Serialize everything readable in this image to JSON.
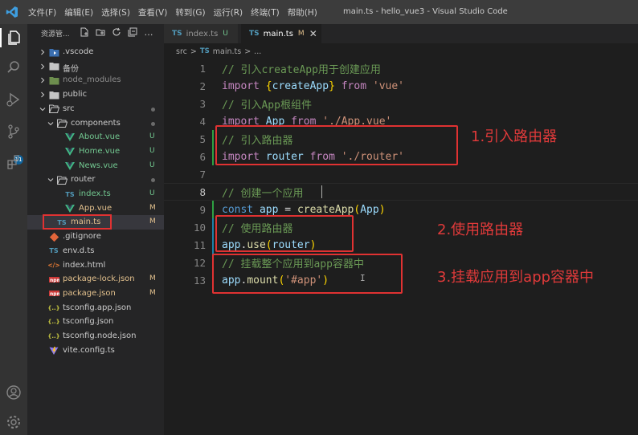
{
  "window": {
    "title": "main.ts - hello_vue3 - Visual Studio Code",
    "menu": [
      "文件(F)",
      "编辑(E)",
      "选择(S)",
      "查看(V)",
      "转到(G)",
      "运行(R)",
      "终端(T)",
      "帮助(H)"
    ]
  },
  "activitybar": {
    "icons": [
      "explorer-icon",
      "search-icon",
      "run-debug-icon",
      "source-control-icon",
      "extensions-icon",
      "account-icon",
      "settings-gear-icon"
    ],
    "scm_badge": "11"
  },
  "sidebar": {
    "title": "资源管...",
    "tree": [
      {
        "name": ".vscode",
        "type": "folder",
        "icon": "vscode-folder-icon",
        "stat": ""
      },
      {
        "name": "备份",
        "type": "folder",
        "icon": "folder-icon",
        "stat": ""
      },
      {
        "name": "node_modules",
        "type": "folder",
        "icon": "node-folder-icon",
        "stat": ""
      },
      {
        "name": "public",
        "type": "folder",
        "icon": "folder-icon",
        "stat": ""
      },
      {
        "name": "src",
        "type": "folder-open",
        "icon": "folder-open-icon",
        "stat": "dot"
      },
      {
        "name": "components",
        "type": "folder-open",
        "icon": "folder-open-icon",
        "stat": "dot"
      },
      {
        "name": "About.vue",
        "type": "vue",
        "icon": "vue-icon",
        "stat": "U"
      },
      {
        "name": "Home.vue",
        "type": "vue",
        "icon": "vue-icon",
        "stat": "U"
      },
      {
        "name": "News.vue",
        "type": "vue",
        "icon": "vue-icon",
        "stat": "U"
      },
      {
        "name": "router",
        "type": "folder-open",
        "icon": "folder-open-icon",
        "stat": "dot"
      },
      {
        "name": "index.ts",
        "type": "ts",
        "icon": "ts-icon",
        "stat": "U"
      },
      {
        "name": "App.vue",
        "type": "vue",
        "icon": "vue-icon",
        "stat": "M"
      },
      {
        "name": "main.ts",
        "type": "ts",
        "icon": "ts-icon",
        "stat": "M"
      },
      {
        "name": ".gitignore",
        "type": "git",
        "icon": "git-icon",
        "stat": ""
      },
      {
        "name": "env.d.ts",
        "type": "ts",
        "icon": "ts-icon",
        "stat": ""
      },
      {
        "name": "index.html",
        "type": "html",
        "icon": "html-icon",
        "stat": ""
      },
      {
        "name": "package-lock.json",
        "type": "npm",
        "icon": "npm-icon",
        "stat": "M"
      },
      {
        "name": "package.json",
        "type": "npm",
        "icon": "npm-icon",
        "stat": "M"
      },
      {
        "name": "tsconfig.app.json",
        "type": "json",
        "icon": "json-icon",
        "stat": ""
      },
      {
        "name": "tsconfig.json",
        "type": "json",
        "icon": "json-icon",
        "stat": ""
      },
      {
        "name": "tsconfig.node.json",
        "type": "json",
        "icon": "json-icon",
        "stat": ""
      },
      {
        "name": "vite.config.ts",
        "type": "vite",
        "icon": "vite-icon",
        "stat": ""
      }
    ]
  },
  "tabs": [
    {
      "badge": "TS",
      "name": "index.ts",
      "status": "U",
      "active": false
    },
    {
      "badge": "TS",
      "name": "main.ts",
      "status": "M",
      "active": true
    }
  ],
  "breadcrumb": {
    "folder": "src",
    "sep": ">",
    "badge": "TS",
    "file": "main.ts",
    "tail": "..."
  },
  "code": {
    "line_numbers": [
      "1",
      "2",
      "3",
      "4",
      "5",
      "6",
      "7",
      "8",
      "9",
      "10",
      "11",
      "12",
      "13"
    ],
    "current_line": "8",
    "l1": "// 引入createApp用于创建应用",
    "l2": {
      "kw": "import",
      "open": "{",
      "name": "createApp",
      "close": "}",
      "from": "from",
      "str": "'vue'"
    },
    "l3": "// 引入App根组件",
    "l4": {
      "kw": "import",
      "name": "App",
      "from": "from",
      "str": "'./App.vue'"
    },
    "l5": "// 引入路由器",
    "l6": {
      "kw": "import",
      "name": "router",
      "from": "from",
      "str": "'./router'"
    },
    "l8": "// 创建一个应用",
    "l9": {
      "kw": "const",
      "name": "app",
      "eq": "=",
      "fn": "createApp",
      "open": "(",
      "arg": "App",
      "close": ")"
    },
    "l10": "// 使用路由器",
    "l11": {
      "obj": "app",
      "dot": ".",
      "fn": "use",
      "open": "(",
      "arg": "router",
      "close": ")"
    },
    "l12": "// 挂载整个应用到app容器中",
    "l13": {
      "obj": "app",
      "dot": ".",
      "fn": "mount",
      "open": "(",
      "str": "'#app'",
      "close": ")"
    }
  },
  "annotations": [
    "1.引入路由器",
    "2.使用路由器",
    "3.挂载应用到app容器中"
  ],
  "colors": {
    "annotation": "#e03232",
    "ts": "#519aba",
    "vue": "#41b883",
    "modified": "#e2c08d",
    "untracked": "#73c991"
  }
}
